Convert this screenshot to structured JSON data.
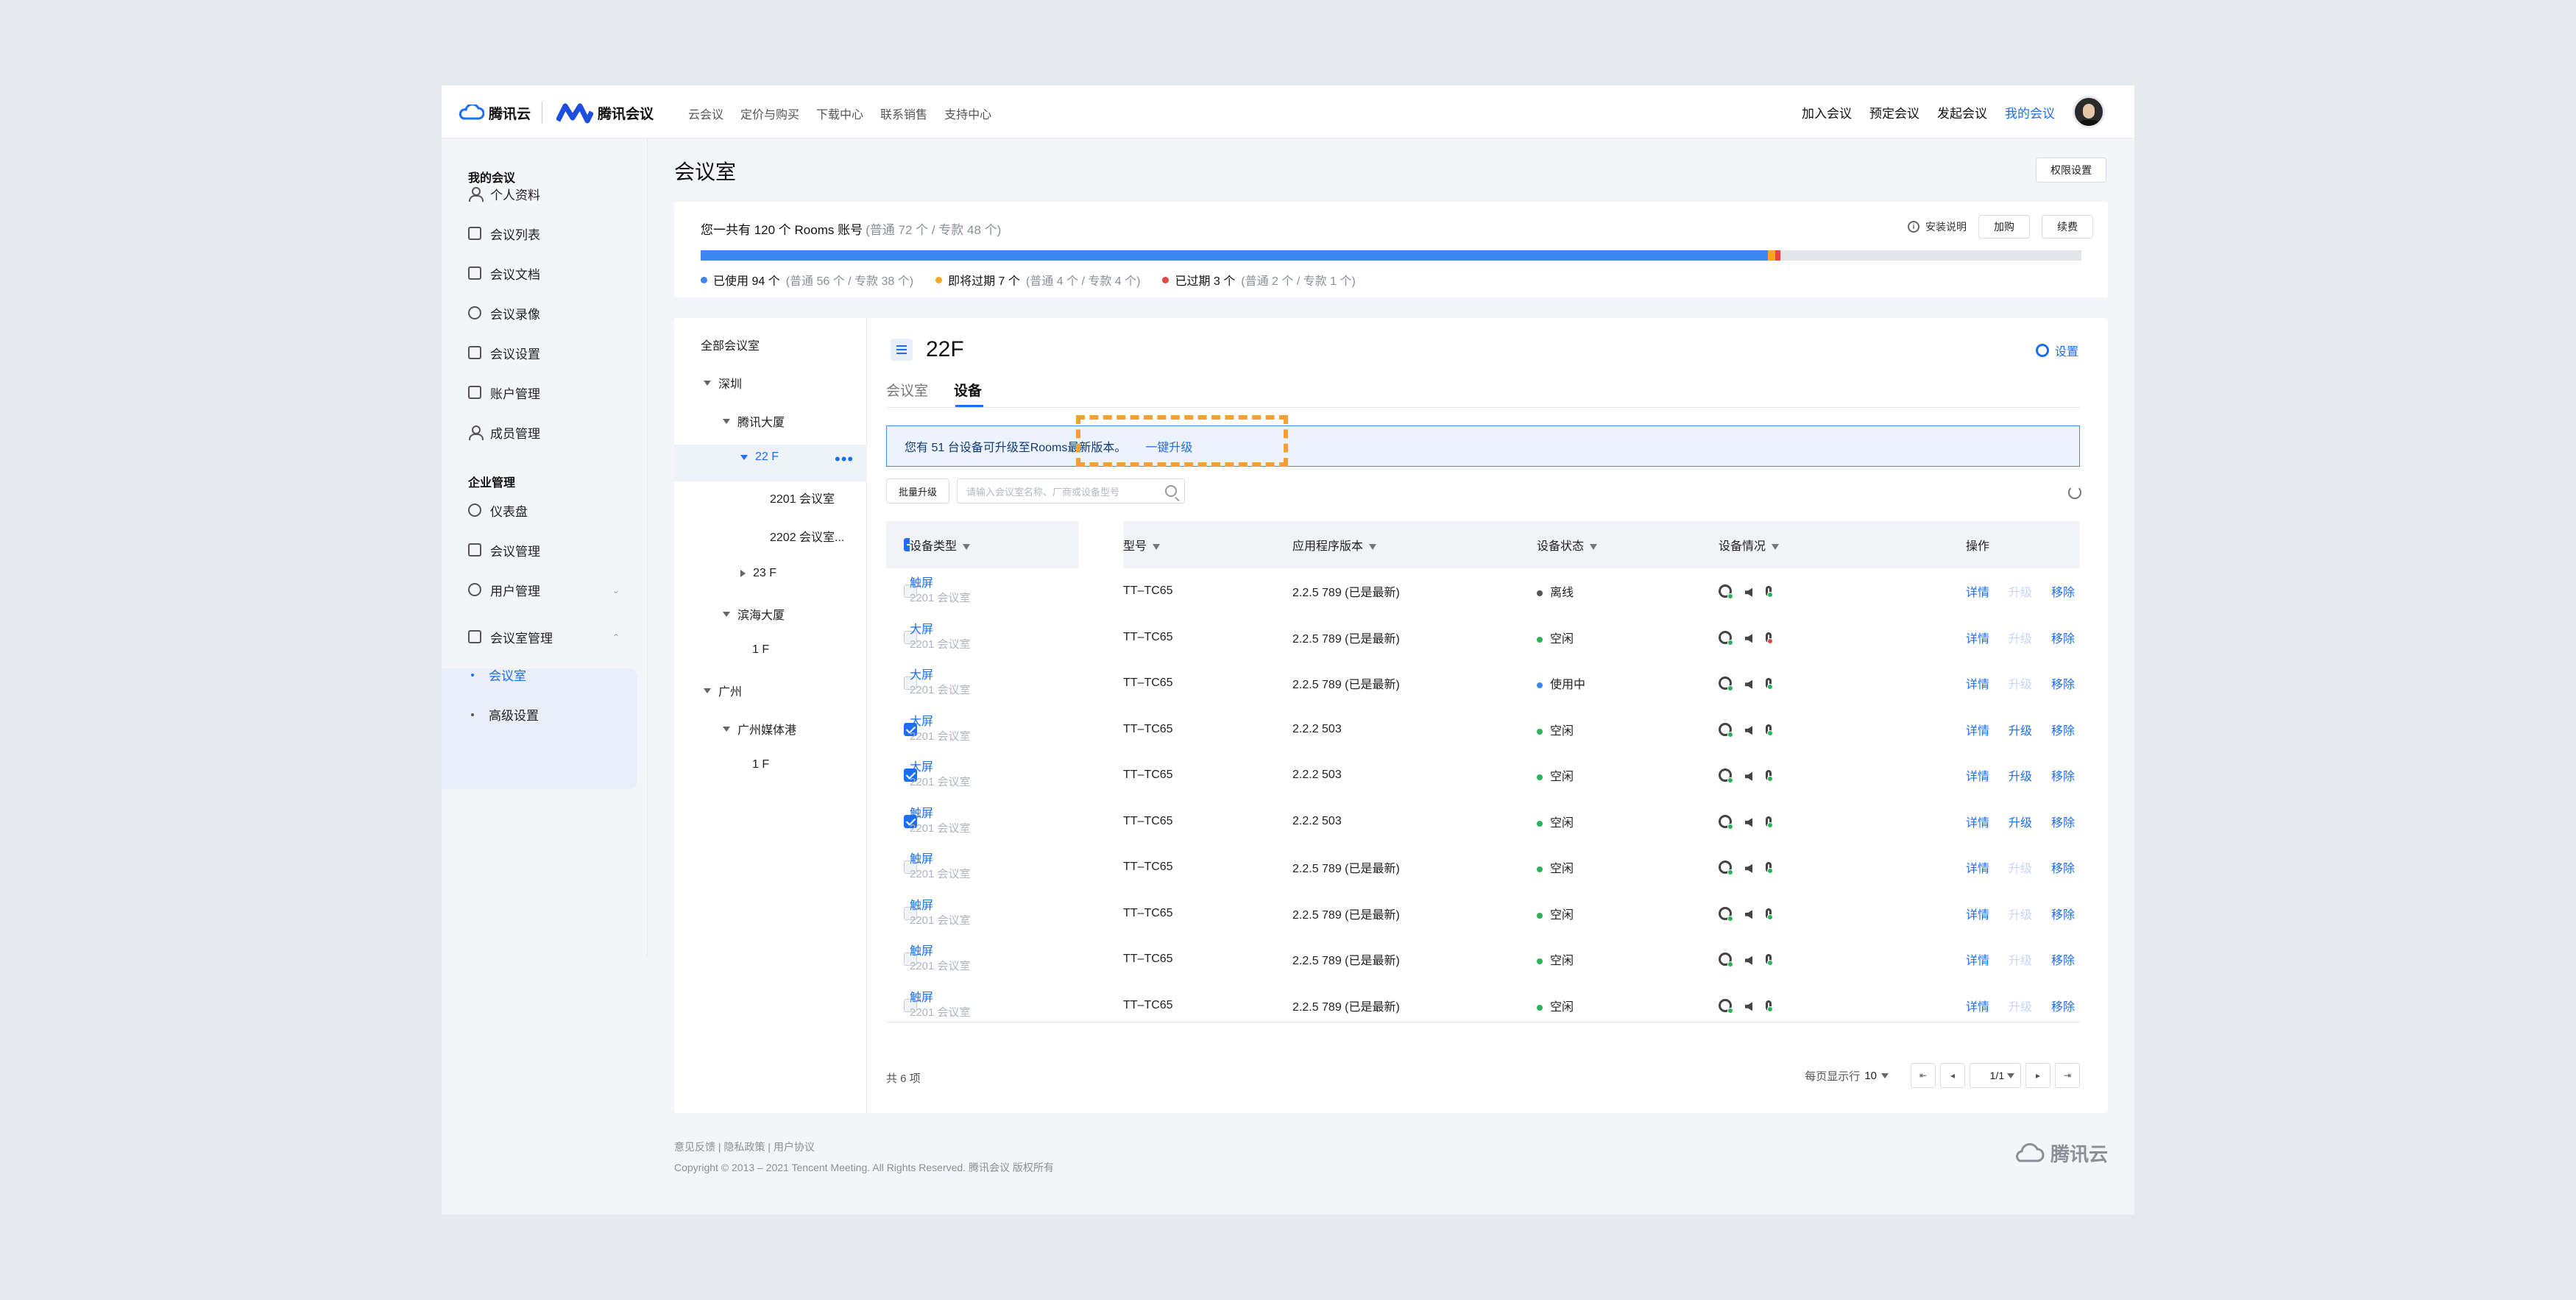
{
  "header": {
    "brand1": "腾讯云",
    "brand2": "腾讯会议",
    "menu": [
      "云会议",
      "定价与购买",
      "下载中心",
      "联系销售",
      "支持中心"
    ],
    "right": [
      "加入会议",
      "预定会议",
      "发起会议",
      "我的会议"
    ]
  },
  "sidebar": {
    "group1": "我的会议",
    "items1": [
      "个人资料",
      "会议列表",
      "会议文档",
      "会议录像",
      "会议设置",
      "账户管理",
      "成员管理"
    ],
    "group2": "企业管理",
    "items2": [
      "仪表盘",
      "会议管理",
      "用户管理",
      "会议室管理"
    ],
    "sub": [
      "会议室",
      "高级设置"
    ]
  },
  "page": {
    "title": "会议室",
    "perm_button": "权限设置"
  },
  "summary": {
    "total": "您一共有 120 个 Rooms 账号",
    "total_detail": "(普通 72 个 / 专款 48 个)",
    "install": "安装说明",
    "buy": "加购",
    "renew": "续费",
    "used_pct": 77.3,
    "expiring_pct": 0.5,
    "expired_pct": 0.4,
    "colors": {
      "used": "#3f86f5",
      "expiring": "#f5a623",
      "expired": "#e64545"
    },
    "legend": [
      {
        "label": "已使用 94 个",
        "detail": "(普通 56 个 / 专款 38 个)"
      },
      {
        "label": "即将过期 7 个",
        "detail": "(普通 4 个 / 专款 4 个)"
      },
      {
        "label": "已过期 3 个",
        "detail": "(普通 2 个 / 专款 1 个)"
      }
    ]
  },
  "tree": {
    "all": "全部会议室",
    "nodes": [
      "深圳",
      "腾讯大厦",
      "22 F",
      "2201 会议室",
      "2202 会议室...",
      "23 F",
      "滨海大厦",
      "1 F",
      "广州",
      "广州媒体港",
      "1 F"
    ]
  },
  "content": {
    "title": "22F",
    "settings": "设置",
    "tabs": [
      "会议室",
      "设备"
    ],
    "notice": "您有 51 台设备可升级至Rooms最新版本。",
    "notice_link": "一键升级",
    "batch": "批量升级",
    "search_placeholder": "请输入会议室名称、厂商或设备型号",
    "columns": [
      "设备类型",
      "型号",
      "应用程序版本",
      "设备状态",
      "设备情况",
      "操作"
    ],
    "rows": [
      {
        "type": "触屏",
        "room": "2201 会议室",
        "model": "TT–TC65",
        "version": "2.2.5 789 (已是最新)",
        "status": "离线",
        "status_color": "#555555",
        "checked": false,
        "upgrade": false,
        "spk_err": false
      },
      {
        "type": "大屏",
        "room": "2201 会议室",
        "model": "TT–TC65",
        "version": "2.2.5 789 (已是最新)",
        "status": "空闲",
        "status_color": "#2bb35a",
        "checked": false,
        "upgrade": false,
        "spk_err": true
      },
      {
        "type": "大屏",
        "room": "2201 会议室",
        "model": "TT–TC65",
        "version": "2.2.5 789 (已是最新)",
        "status": "使用中",
        "status_color": "#3f86f5",
        "checked": false,
        "upgrade": false,
        "spk_err": false
      },
      {
        "type": "大屏",
        "room": "2201 会议室",
        "model": "TT–TC65",
        "version": "2.2.2 503",
        "status": "空闲",
        "status_color": "#2bb35a",
        "checked": true,
        "upgrade": true,
        "spk_err": false
      },
      {
        "type": "大屏",
        "room": "2201 会议室",
        "model": "TT–TC65",
        "version": "2.2.2 503",
        "status": "空闲",
        "status_color": "#2bb35a",
        "checked": true,
        "upgrade": true,
        "spk_err": false
      },
      {
        "type": "触屏",
        "room": "2201 会议室",
        "model": "TT–TC65",
        "version": "2.2.2 503",
        "status": "空闲",
        "status_color": "#2bb35a",
        "checked": true,
        "upgrade": true,
        "spk_err": false
      },
      {
        "type": "触屏",
        "room": "2201 会议室",
        "model": "TT–TC65",
        "version": "2.2.5 789 (已是最新)",
        "status": "空闲",
        "status_color": "#2bb35a",
        "checked": false,
        "upgrade": false,
        "spk_err": false
      },
      {
        "type": "触屏",
        "room": "2201 会议室",
        "model": "TT–TC65",
        "version": "2.2.5 789 (已是最新)",
        "status": "空闲",
        "status_color": "#2bb35a",
        "checked": false,
        "upgrade": false,
        "spk_err": false
      },
      {
        "type": "触屏",
        "room": "2201 会议室",
        "model": "TT–TC65",
        "version": "2.2.5 789 (已是最新)",
        "status": "空闲",
        "status_color": "#2bb35a",
        "checked": false,
        "upgrade": false,
        "spk_err": false
      },
      {
        "type": "触屏",
        "room": "2201 会议室",
        "model": "TT–TC65",
        "version": "2.2.5 789 (已是最新)",
        "status": "空闲",
        "status_color": "#2bb35a",
        "checked": false,
        "upgrade": false,
        "spk_err": false
      }
    ],
    "ops": [
      "详情",
      "升级",
      "移除"
    ],
    "total": "共 6 项",
    "page_size_label": "每页显示行",
    "page_size": "10",
    "page": "1/1"
  },
  "footer": {
    "links": "意见反馈 | 隐私政策 | 用户协议",
    "copyright": "Copyright © 2013 – 2021 Tencent Meeting. All Rights Reserved.  腾讯会议 版权所有",
    "logo": "腾讯云"
  }
}
